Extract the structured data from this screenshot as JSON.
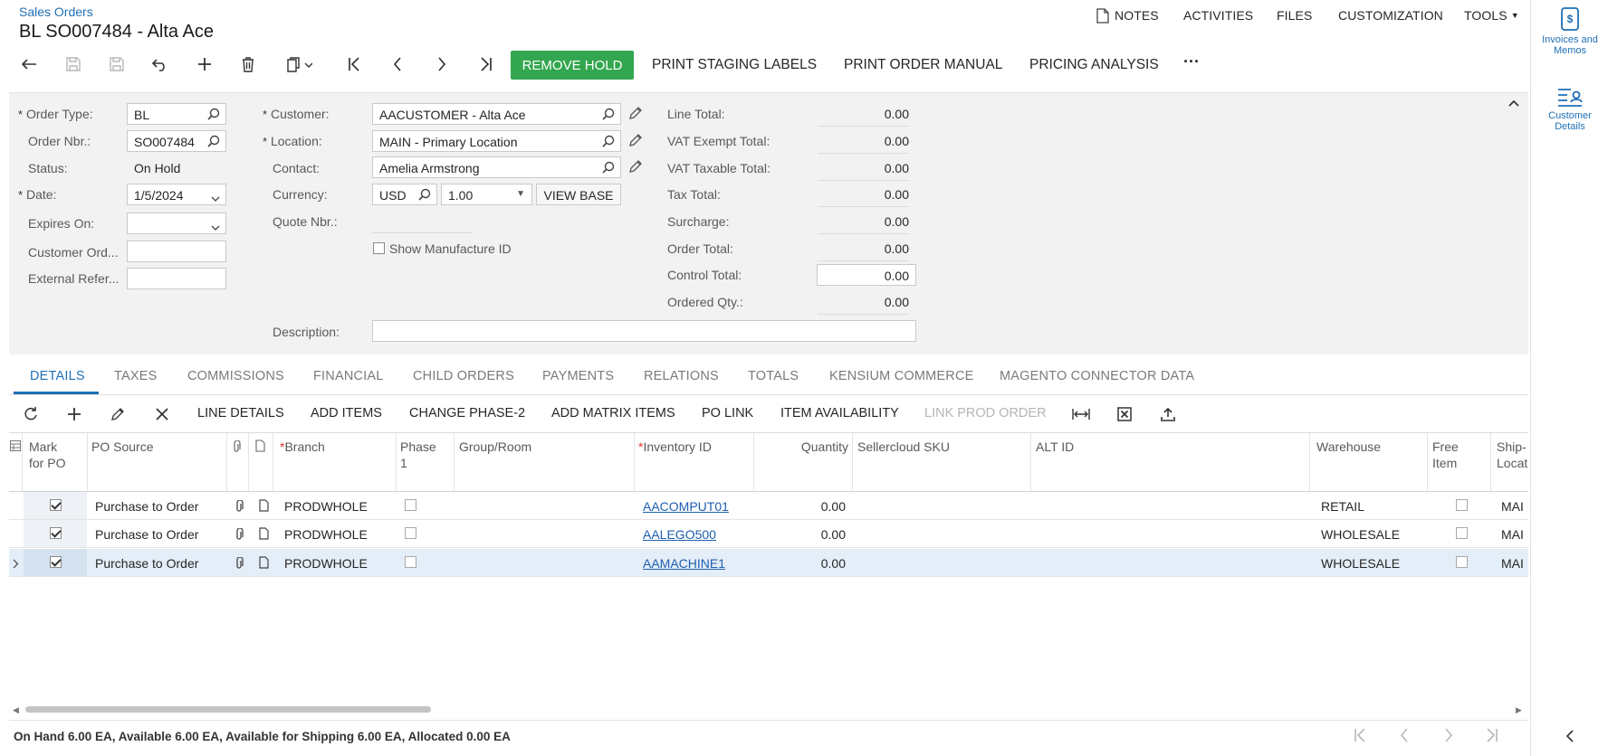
{
  "header": {
    "breadcrumb": "Sales Orders",
    "title": "BL SO007484 - Alta Ace",
    "nav": {
      "notes": "NOTES",
      "activities": "ACTIVITIES",
      "files": "FILES",
      "customization": "CUSTOMIZATION",
      "tools": "TOOLS"
    }
  },
  "toolbar": {
    "remove_hold": "REMOVE HOLD",
    "print_staging": "PRINT STAGING LABELS",
    "print_order": "PRINT ORDER MANUAL",
    "pricing": "PRICING ANALYSIS",
    "more": "···"
  },
  "right_panel": {
    "invoices": "Invoices and Memos",
    "customer_details": "Customer Details"
  },
  "form": {
    "order_type_label": "Order Type:",
    "order_type": "BL",
    "order_nbr_label": "Order Nbr.:",
    "order_nbr": "SO007484",
    "status_label": "Status:",
    "status": "On Hold",
    "date_label": "Date:",
    "date": "1/5/2024",
    "expires_label": "Expires On:",
    "expires": "",
    "customer_ord_label": "Customer Ord...",
    "customer_ord": "",
    "external_ref_label": "External Refer...",
    "external_ref": "",
    "customer_label": "Customer:",
    "customer": "AACUSTOMER - Alta Ace",
    "location_label": "Location:",
    "location": "MAIN - Primary Location",
    "contact_label": "Contact:",
    "contact": "Amelia Armstrong",
    "currency_label": "Currency:",
    "currency": "USD",
    "rate": "1.00",
    "view_base": "VIEW BASE",
    "quote_label": "Quote Nbr.:",
    "quote": "",
    "show_mfg": "Show Manufacture ID",
    "description_label": "Description:",
    "description": "",
    "totals": {
      "line_total_label": "Line Total:",
      "line_total": "0.00",
      "vat_exempt_label": "VAT Exempt Total:",
      "vat_exempt": "0.00",
      "vat_taxable_label": "VAT Taxable Total:",
      "vat_taxable": "0.00",
      "tax_total_label": "Tax Total:",
      "tax_total": "0.00",
      "surcharge_label": "Surcharge:",
      "surcharge": "0.00",
      "order_total_label": "Order Total:",
      "order_total": "0.00",
      "control_total_label": "Control Total:",
      "control_total": "0.00",
      "ordered_qty_label": "Ordered Qty.:",
      "ordered_qty": "0.00"
    }
  },
  "tabs": [
    "DETAILS",
    "TAXES",
    "COMMISSIONS",
    "FINANCIAL",
    "CHILD ORDERS",
    "PAYMENTS",
    "RELATIONS",
    "TOTALS",
    "KENSIUM COMMERCE",
    "MAGENTO CONNECTOR DATA"
  ],
  "grid_toolbar": {
    "line_details": "LINE DETAILS",
    "add_items": "ADD ITEMS",
    "change_phase": "CHANGE PHASE-2",
    "add_matrix": "ADD MATRIX ITEMS",
    "po_link": "PO LINK",
    "item_avail": "ITEM AVAILABILITY",
    "link_prod": "LINK PROD ORDER"
  },
  "grid": {
    "headers": {
      "mark": "Mark for PO",
      "po_source": "PO Source",
      "branch": "Branch",
      "phase": "Phase 1",
      "group": "Group/Room",
      "inventory": "Inventory ID",
      "quantity": "Quantity",
      "sku": "Sellercloud SKU",
      "alt": "ALT ID",
      "warehouse": "Warehouse",
      "free": "Free Item",
      "ship": "Ship-Locat"
    },
    "rows": [
      {
        "po_source": "Purchase to Order",
        "branch": "PRODWHOLE",
        "inventory": "AACOMPUT01",
        "quantity": "0.00",
        "warehouse": "RETAIL",
        "ship": "MAI"
      },
      {
        "po_source": "Purchase to Order",
        "branch": "PRODWHOLE",
        "inventory": "AALEGO500",
        "quantity": "0.00",
        "warehouse": "WHOLESALE",
        "ship": "MAI"
      },
      {
        "po_source": "Purchase to Order",
        "branch": "PRODWHOLE",
        "inventory": "AAMACHINE1",
        "quantity": "0.00",
        "warehouse": "WHOLESALE",
        "ship": "MAI"
      }
    ]
  },
  "status_bar": "On Hand 6.00 EA, Available 6.00 EA, Available for Shipping 6.00 EA, Allocated 0.00 EA",
  "colors": {
    "accent": "#1f6fb5",
    "green": "#33a74f",
    "selected_row": "#e4eef8"
  }
}
